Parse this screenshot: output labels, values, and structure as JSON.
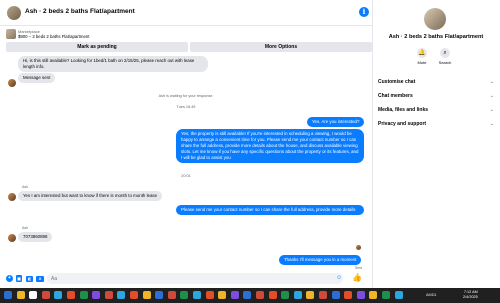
{
  "header": {
    "title": "Ash · 2 beds 2 baths Flat/apartment",
    "chevron_icon": "chevron-down-icon",
    "info_icon": "info-icon"
  },
  "listing": {
    "label": "Marketplace",
    "title": "$900 – 2 beds 2 baths Flat/apartment",
    "mark_pending": "Mark as pending",
    "more_options": "More Options"
  },
  "messages": {
    "m1": "Hi, is this still available? Looking for 1bed/1 bath on 2/15/25, please reach out with lease length info.",
    "m2": "Message sent",
    "sys_waiting": "Ash is waiting for your response.",
    "timestamp": "Tues 16:49",
    "m3": "Yes. Are you interested?",
    "m4": "Yes, the property is still available! If you're interested in scheduling a viewing, I would be happy to arrange a convenient time for you. Please send me your contact number so I can share the full address, provide more details about the house, and discuss available viewing slots. Let me know if you have any specific questions about the property or its features, and I will be glad to assist you",
    "sys_time2": "20:01",
    "sender1": "Ash",
    "m5": "Yes I am interested but want to know if there is month to month lease",
    "m6": "Please send me your contact number so I can share the full address, provide more details",
    "sender2": "Ash",
    "m7": "7073860898",
    "m8": "Thanks I'll message you in a moment",
    "sent_status": "Sent"
  },
  "composer": {
    "placeholder": "Aa"
  },
  "right_panel": {
    "name": "Ash · 2 beds 2 baths Flat/apartment",
    "mute_label": "Mute",
    "search_label": "Search",
    "rows": [
      "Customise chat",
      "Chat members",
      "Media, files and links",
      "Privacy and support"
    ]
  },
  "taskbar": {
    "ticker": "AMD1",
    "time": "7:12 AM",
    "date": "2/4/2025"
  },
  "colors": {
    "accent": "#0a7cff",
    "incoming_bubble": "#e4e6eb",
    "taskbar": "#202020"
  }
}
